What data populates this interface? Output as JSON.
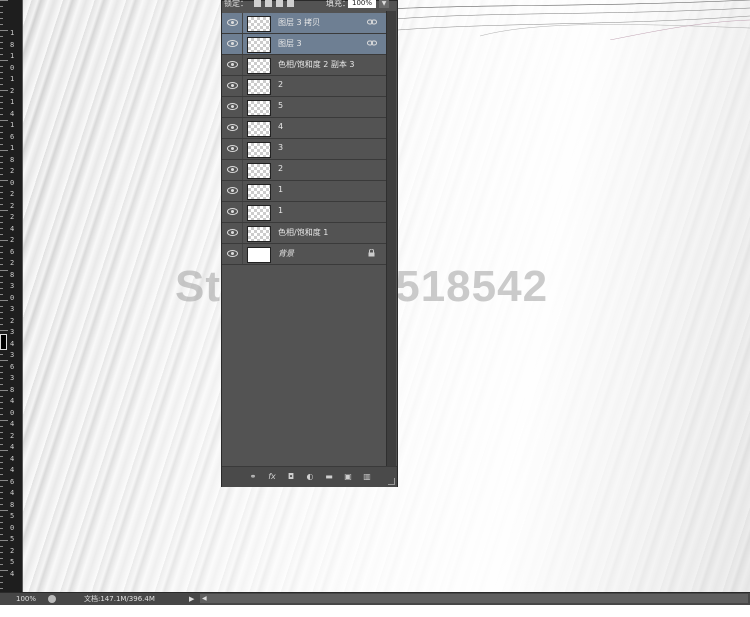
{
  "layers_panel": {
    "lock_label": "锁定：",
    "fill_label": "填充：",
    "fill_value": "100%",
    "layers": [
      {
        "name": "图层 3 拷贝",
        "selected": true,
        "linked": true,
        "thumb": "transparent"
      },
      {
        "name": "图层 3",
        "selected": true,
        "linked": true,
        "thumb": "transparent"
      },
      {
        "name": "色相/饱和度 2 副本 3",
        "selected": false,
        "thumb": "transparent"
      },
      {
        "name": "2",
        "selected": false,
        "thumb": "transparent"
      },
      {
        "name": "5",
        "selected": false,
        "thumb": "transparent"
      },
      {
        "name": "4",
        "selected": false,
        "thumb": "transparent"
      },
      {
        "name": "3",
        "selected": false,
        "thumb": "transparent"
      },
      {
        "name": "2",
        "selected": false,
        "thumb": "transparent"
      },
      {
        "name": "1",
        "selected": false,
        "thumb": "transparent"
      },
      {
        "name": "1",
        "selected": false,
        "thumb": "transparent"
      },
      {
        "name": "色相/饱和度 1",
        "selected": false,
        "thumb": "transparent"
      },
      {
        "name": "背景",
        "selected": false,
        "locked": true,
        "italic": true,
        "thumb": "white"
      }
    ],
    "footer_icons": [
      "link-layers-icon",
      "fx-icon",
      "layer-mask-icon",
      "adjustment-layer-icon",
      "group-folder-icon",
      "new-layer-icon",
      "trash-icon"
    ]
  },
  "canvas": {
    "watermark": "Store No: 518542"
  },
  "ruler": {
    "labels": [
      "1",
      "8",
      "1",
      "0",
      "1",
      "2",
      "1",
      "4",
      "1",
      "6",
      "1",
      "8",
      "2",
      "0",
      "2",
      "2",
      "2",
      "4",
      "2",
      "6",
      "2",
      "8",
      "3",
      "0",
      "3",
      "2",
      "3",
      "4",
      "3",
      "6",
      "3",
      "8",
      "4",
      "0",
      "4",
      "2",
      "4",
      "4",
      "4",
      "6",
      "4",
      "8",
      "5",
      "0",
      "5",
      "2",
      "5",
      "4"
    ]
  },
  "status_bar": {
    "zoom": "100%",
    "doc_info": "文档:147.1M/396.4M"
  },
  "colors": {
    "selected_layer": "#6e7f93",
    "panel_bg": "#535353"
  }
}
